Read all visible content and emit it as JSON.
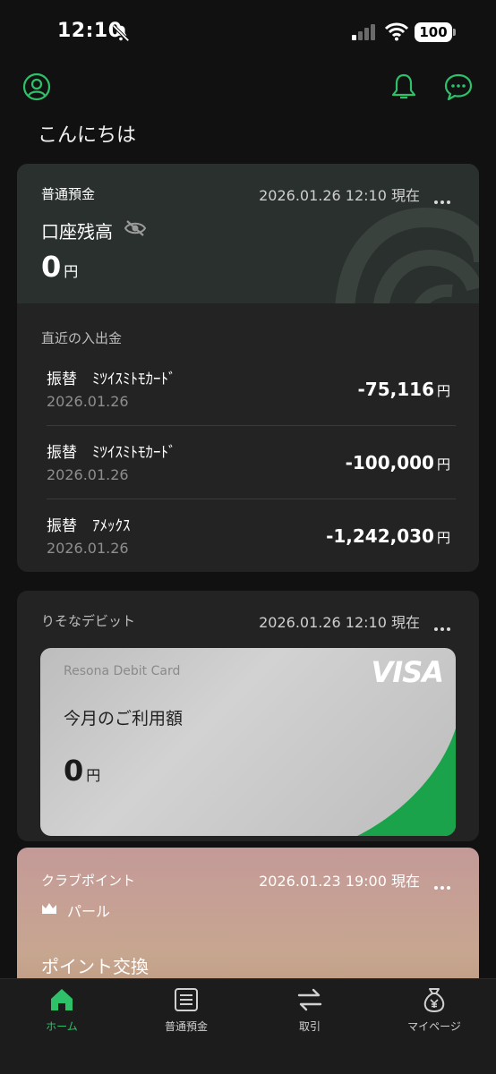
{
  "status_bar": {
    "time": "12:10",
    "battery": "100"
  },
  "header": {
    "greeting": "こんにちは",
    "profile_icon": "user-circle-icon",
    "notification_icon": "bell-icon",
    "chat_icon": "chat-bubble-icon",
    "accent_color": "#2fc06a"
  },
  "account": {
    "type_label": "普通預金",
    "timestamp": "2026.01.26 12:10 現在",
    "balance_label": "口座残高",
    "balance_value": "0",
    "currency": "円",
    "recent_label": "直近の入出金",
    "transactions": [
      {
        "name": "振替　ﾐﾂｲｽﾐﾄﾓｶｰﾄﾞ",
        "date": "2026.01.26",
        "amount": "-75,116",
        "currency": "円"
      },
      {
        "name": "振替　ﾐﾂｲｽﾐﾄﾓｶｰﾄﾞ",
        "date": "2026.01.26",
        "amount": "-100,000",
        "currency": "円"
      },
      {
        "name": "振替　ｱﾒｯｸｽ",
        "date": "2026.01.26",
        "amount": "-1,242,030",
        "currency": "円"
      }
    ]
  },
  "debit": {
    "label": "りそなデビット",
    "timestamp": "2026.01.26 12:10 現在",
    "card_brand": "Resona Debit Card",
    "network": "VISA",
    "usage_label": "今月のご利用額",
    "usage_value": "0",
    "currency": "円"
  },
  "club": {
    "label": "クラブポイント",
    "timestamp": "2026.01.23 19:00 現在",
    "rank": "パール",
    "exchange_label": "ポイント交換"
  },
  "tabbar": {
    "items": [
      {
        "label": "ホーム",
        "icon": "home-icon",
        "active": true
      },
      {
        "label": "普通預金",
        "icon": "list-icon",
        "active": false
      },
      {
        "label": "取引",
        "icon": "transfer-icon",
        "active": false
      },
      {
        "label": "マイページ",
        "icon": "money-bag-icon",
        "active": false
      }
    ]
  }
}
